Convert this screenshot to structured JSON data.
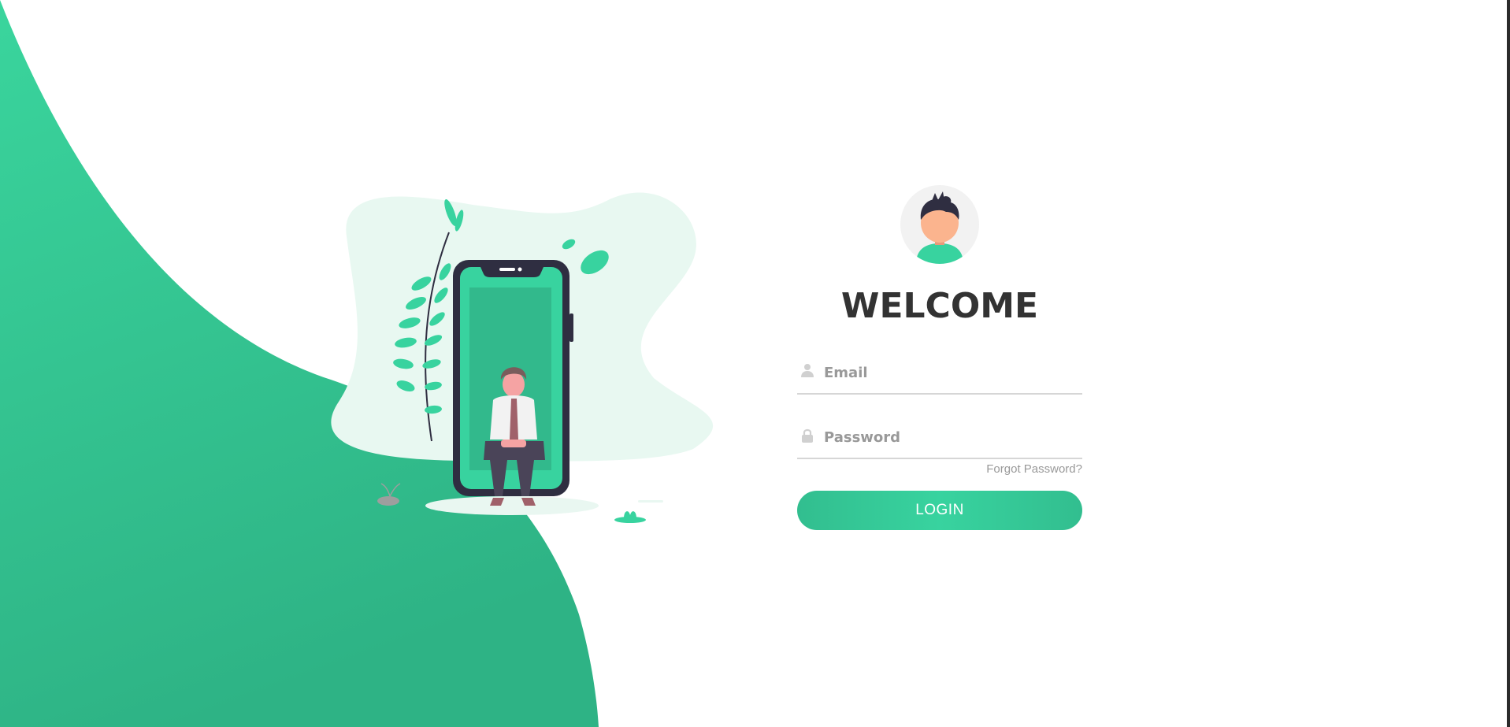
{
  "login": {
    "title": "WELCOME",
    "email": {
      "placeholder": "Email",
      "icon": "user-icon"
    },
    "password": {
      "placeholder": "Password",
      "icon": "lock-icon"
    },
    "forgot_label": "Forgot Password?",
    "submit_label": "LOGIN"
  },
  "colors": {
    "accent": "#38d39f",
    "accent_dark": "#32be8f",
    "title": "#333333",
    "muted": "#999999"
  }
}
